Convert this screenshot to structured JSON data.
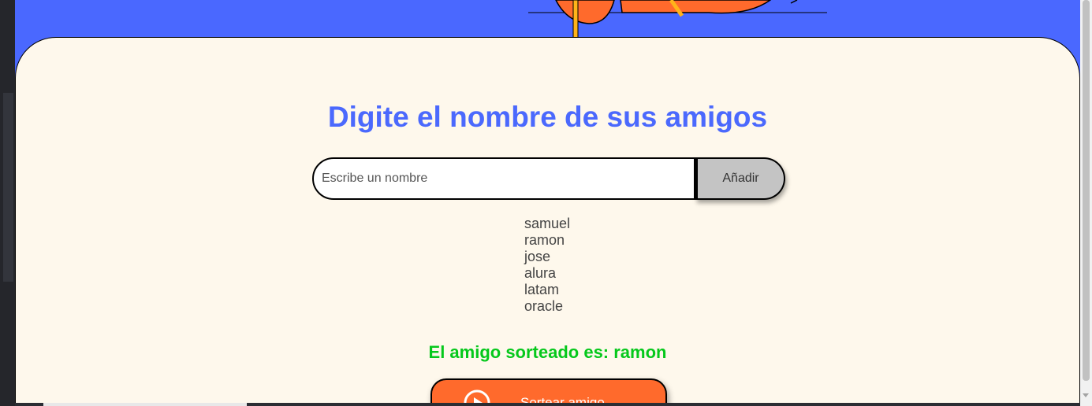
{
  "header": {
    "title": "Digite el nombre de sus amigos"
  },
  "form": {
    "input_placeholder": "Escribe un nombre",
    "input_value": "",
    "add_button_label": "Añadir"
  },
  "friends": [
    "samuel",
    "ramon",
    "jose",
    "alura",
    "latam",
    "oracle"
  ],
  "result": {
    "text": "El amigo sorteado es: ramon"
  },
  "draw_button": {
    "label": "Sortear amigo",
    "icon": "play-circle-icon"
  },
  "colors": {
    "background": "#4a68ff",
    "card": "#fef8ec",
    "title": "#4b69fd",
    "result": "#05c81b",
    "draw_button": "#ff6a2c",
    "add_button": "#c4c4c4"
  }
}
